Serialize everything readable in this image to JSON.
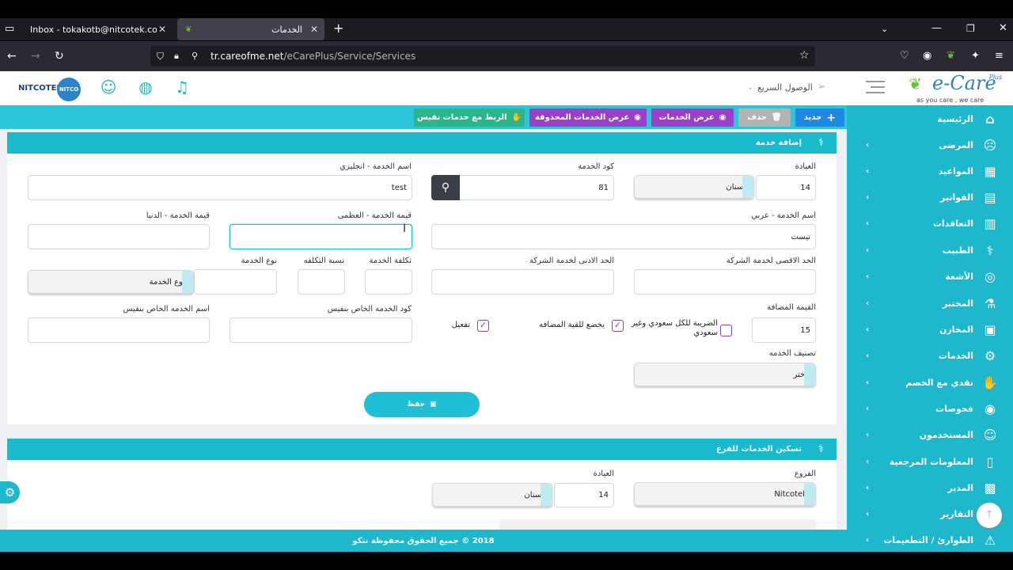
{
  "browser": {
    "tabs": [
      {
        "label": "Inbox - tokakotb@nitcotek.com - N"
      },
      {
        "label": "الخدمات"
      }
    ],
    "url_host": "tr.careofme.net",
    "url_path": "/eCarePlus/Service/Services"
  },
  "header": {
    "brand_left": "NITCOTEK",
    "brand_left_badge": "NITCO",
    "quick_access": "الوصول السريع",
    "logo_text": "e-Care",
    "logo_plus": "Plus",
    "logo_tagline": "as you care , we care"
  },
  "actions": {
    "new": "جديد",
    "delete": "حذف",
    "show_services": "عرض الخدمات",
    "show_deleted": "عرض الخدمات المحذوفة",
    "link_nafees": "الربط مع خدمات نفيس"
  },
  "sidebar": {
    "items": [
      {
        "label": "الرئيسية",
        "icon": "home-icon",
        "glyph": "⌂"
      },
      {
        "label": "المرضى",
        "icon": "patients-icon",
        "glyph": "☹"
      },
      {
        "label": "المواعيد",
        "icon": "calendar-icon",
        "glyph": "▦"
      },
      {
        "label": "الفواتير",
        "icon": "invoice-icon",
        "glyph": "▤"
      },
      {
        "label": "التعاقدات",
        "icon": "clipboard-icon",
        "glyph": "▥"
      },
      {
        "label": "الطبيب",
        "icon": "stethoscope-icon",
        "glyph": "⚕"
      },
      {
        "label": "الأشعة",
        "icon": "radiology-icon",
        "glyph": "◎"
      },
      {
        "label": "المختبر",
        "icon": "lab-icon",
        "glyph": "⚗"
      },
      {
        "label": "المخازن",
        "icon": "warehouse-icon",
        "glyph": "▣"
      },
      {
        "label": "الخدمات",
        "icon": "gear-icon",
        "glyph": "⚙"
      },
      {
        "label": "نقدي مع الخصم",
        "icon": "cash-icon",
        "glyph": "✋"
      },
      {
        "label": "فحوصات",
        "icon": "exam-icon",
        "glyph": "◉"
      },
      {
        "label": "المستخدمون",
        "icon": "users-icon",
        "glyph": "☺"
      },
      {
        "label": "المعلومات المرجعية",
        "icon": "bookmark-icon",
        "glyph": "▯"
      },
      {
        "label": "المدير",
        "icon": "manager-icon",
        "glyph": "▩"
      },
      {
        "label": "التقارير",
        "icon": "reports-icon",
        "glyph": "▧"
      },
      {
        "label": "الطوارئ / التطعيمات",
        "icon": "siren-icon",
        "glyph": "⚠"
      }
    ]
  },
  "form": {
    "title": "إضافة خدمة",
    "clinic_label": "العيادة",
    "clinic_code": "14",
    "clinic_name": "اسنان",
    "service_code_label": "كود الخدمة",
    "service_code": "81",
    "name_en_label": "اسم الخدمة - انجليزي",
    "name_en": "test",
    "name_ar_label": "اسم الخدمة - عربي",
    "name_ar": "تيست",
    "max_value_label": "قيمة الخدمة - العظمى",
    "max_value": "",
    "min_value_label": "قيمة الخدمة - الدنيا",
    "min_value": "",
    "company_max_label": "الحد الاقصى لخدمة الشركة",
    "company_min_label": "الحد الادنى لخدمة الشركة",
    "cost_label": "تكلفة الخدمة",
    "cost_ratio_label": "نسبة التكلفه",
    "type_label": "نوع الخدمة",
    "type_select": "نوع الخدمة",
    "vat_label": "القيمة المضافة",
    "vat_value": "15",
    "tax_all_label": "الضريبة للكل سعودي وغير سعودي",
    "vat_subject_label": "يخضع للقية المضافه",
    "activate_label": "تفعيل",
    "nafees_code_label": "كود الخدمه الخاص بنفيس",
    "nafees_name_label": "اسم الخدمه الخاص بنفيس",
    "category_label": "تصنيف الخدمه",
    "category_select": "اختر",
    "save": "حفظ"
  },
  "branch_panel": {
    "title": "تسكين الخدمات للفرع",
    "branches_label": "الفروع",
    "branch_value": "Nitcotek",
    "clinic_label": "العيادة",
    "clinic_code": "14",
    "clinic_name": "اسنان"
  },
  "footer": {
    "text": "2018 © جميع الحقوق محفوظة نتكو"
  },
  "colors": {
    "accent": "#1ab9cc",
    "new_button": "#1e88e5",
    "purple_button": "#9c3fc7",
    "green_button": "#2bb68a",
    "delete_button": "#b0b0b0"
  }
}
